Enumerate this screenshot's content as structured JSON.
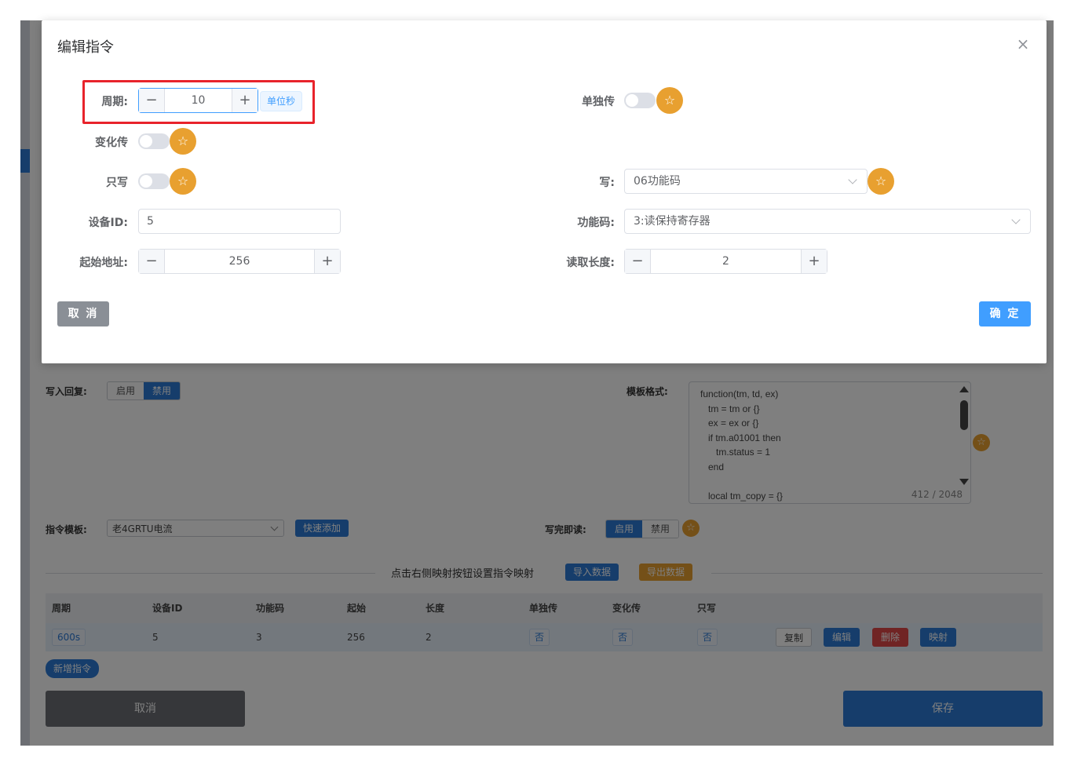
{
  "background": {
    "write_reply": {
      "label": "写入回复:",
      "options": [
        "启用",
        "禁用"
      ],
      "selected": "禁用"
    },
    "template_format": {
      "label": "模板格式:",
      "code": "function(tm, td, ex)\n   tm = tm or {}\n   ex = ex or {}\n   if tm.a01001 then\n      tm.status = 1\n   end\n\n   local tm_copy = {}",
      "counter": "412 / 2048"
    },
    "command_template": {
      "label": "指令模板:",
      "value": "老4GRTU电流",
      "quick_add": "快速添加"
    },
    "write_then_read": {
      "label": "写完即读:",
      "options": [
        "启用",
        "禁用"
      ],
      "selected": "启用"
    },
    "mapping_hint": "点击右侧映射按钮设置指令映射",
    "import_button": "导入数据",
    "export_button": "导出数据",
    "table": {
      "headers": [
        "周期",
        "设备ID",
        "功能码",
        "起始",
        "长度",
        "单独传",
        "变化传",
        "只写"
      ],
      "rows": [
        {
          "period": "600s",
          "device_id": "5",
          "function_code": "3",
          "start": "256",
          "length": "2",
          "single": "否",
          "change": "否",
          "write_only": "否"
        }
      ],
      "row_actions": [
        "复制",
        "编辑",
        "删除",
        "映射"
      ]
    },
    "add_command": "新增指令",
    "cancel": "取消",
    "save": "保存"
  },
  "modal": {
    "title": "编辑指令",
    "period": {
      "label": "周期:",
      "value": "10",
      "unit": "单位秒"
    },
    "single_send": {
      "label": "单独传",
      "on": false
    },
    "change_send": {
      "label": "变化传",
      "on": false
    },
    "write_only": {
      "label": "只写",
      "on": false
    },
    "write": {
      "label": "写:",
      "value": "06功能码"
    },
    "device_id": {
      "label": "设备ID:",
      "value": "5"
    },
    "function_code": {
      "label": "功能码:",
      "value": "3:读保持寄存器"
    },
    "start_address": {
      "label": "起始地址:",
      "value": "256"
    },
    "read_length": {
      "label": "读取长度:",
      "value": "2"
    },
    "cancel": "取 消",
    "confirm": "确 定"
  },
  "colors": {
    "primary": "#2d7bd6",
    "star": "#e8a030",
    "danger": "#e04848",
    "highlight": "#e8232b",
    "confirm": "#409eff"
  }
}
